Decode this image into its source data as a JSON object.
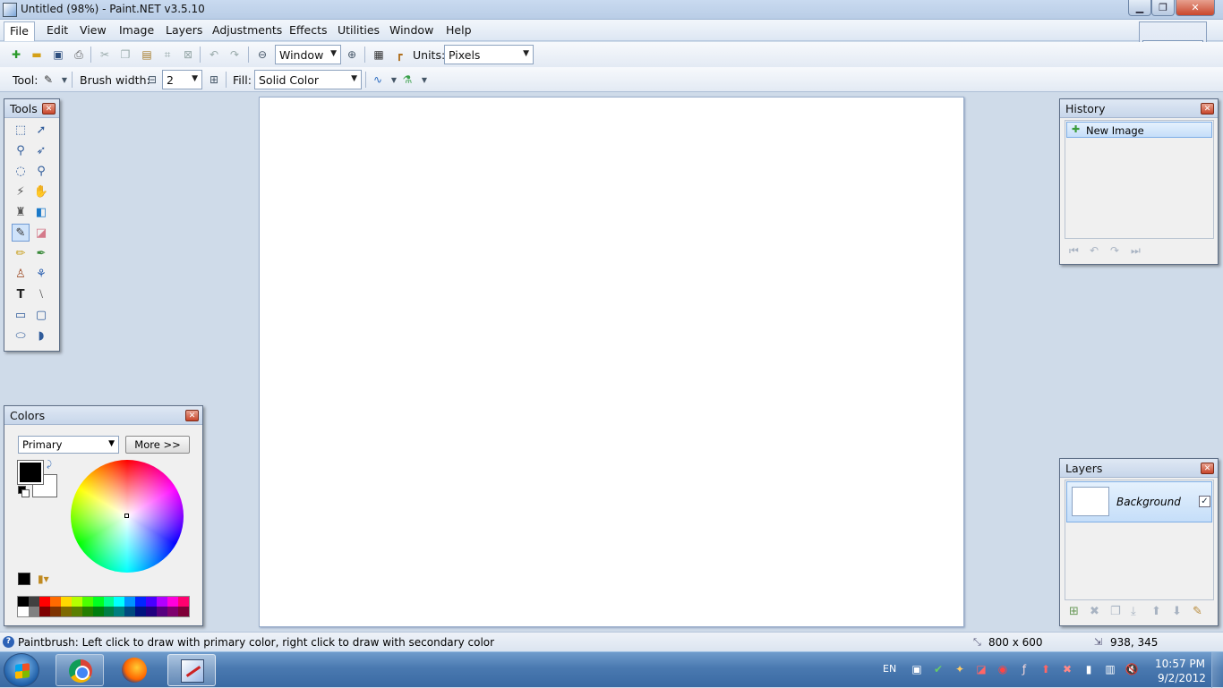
{
  "window": {
    "title": "Untitled (98%) - Paint.NET v3.5.10",
    "min_icon": "minimize-icon",
    "max_icon": "maximize-icon",
    "close_icon": "close-icon"
  },
  "menu": [
    "File",
    "Edit",
    "View",
    "Image",
    "Layers",
    "Adjustments",
    "Effects",
    "Utilities",
    "Window",
    "Help"
  ],
  "toolbar": {
    "zoom_value": "Window",
    "units_label": "Units:",
    "units_value": "Pixels",
    "tool_label": "Tool:",
    "brush_width_label": "Brush width:",
    "brush_width_value": "2",
    "fill_label": "Fill:",
    "fill_value": "Solid Color"
  },
  "panels": {
    "tools_title": "Tools",
    "colors_title": "Colors",
    "history_title": "History",
    "layers_title": "Layers"
  },
  "colors": {
    "mode": "Primary",
    "more_button": "More >>",
    "primary": "#000000",
    "secondary": "#ffffff",
    "palette_top": [
      "#000000",
      "#404040",
      "#ff0000",
      "#ff6a00",
      "#ffd800",
      "#b6ff00",
      "#4cff00",
      "#00ff21",
      "#00ff90",
      "#00ffff",
      "#0094ff",
      "#0026ff",
      "#4800ff",
      "#b200ff",
      "#ff00dc",
      "#ff006e"
    ],
    "palette_bottom": [
      "#ffffff",
      "#808080",
      "#7f0000",
      "#7f3300",
      "#7f6a00",
      "#5b7f00",
      "#267f00",
      "#007f0e",
      "#007f46",
      "#007f7f",
      "#004a7f",
      "#00137f",
      "#21007f",
      "#57007f",
      "#7f006e",
      "#7f0037"
    ]
  },
  "history": {
    "items": [
      "New Image"
    ]
  },
  "layers": {
    "items": [
      {
        "name": "Background",
        "visible": true
      }
    ]
  },
  "statusbar": {
    "help_text": "Paintbrush: Left click to draw with primary color, right click to draw with secondary color",
    "image_size": "800 x 600",
    "cursor_position": "938, 345"
  },
  "taskbar": {
    "language": "EN",
    "time": "10:57 PM",
    "date": "9/2/2012",
    "apps": [
      "chrome-icon",
      "firefox-icon",
      "paintnet-icon"
    ]
  }
}
